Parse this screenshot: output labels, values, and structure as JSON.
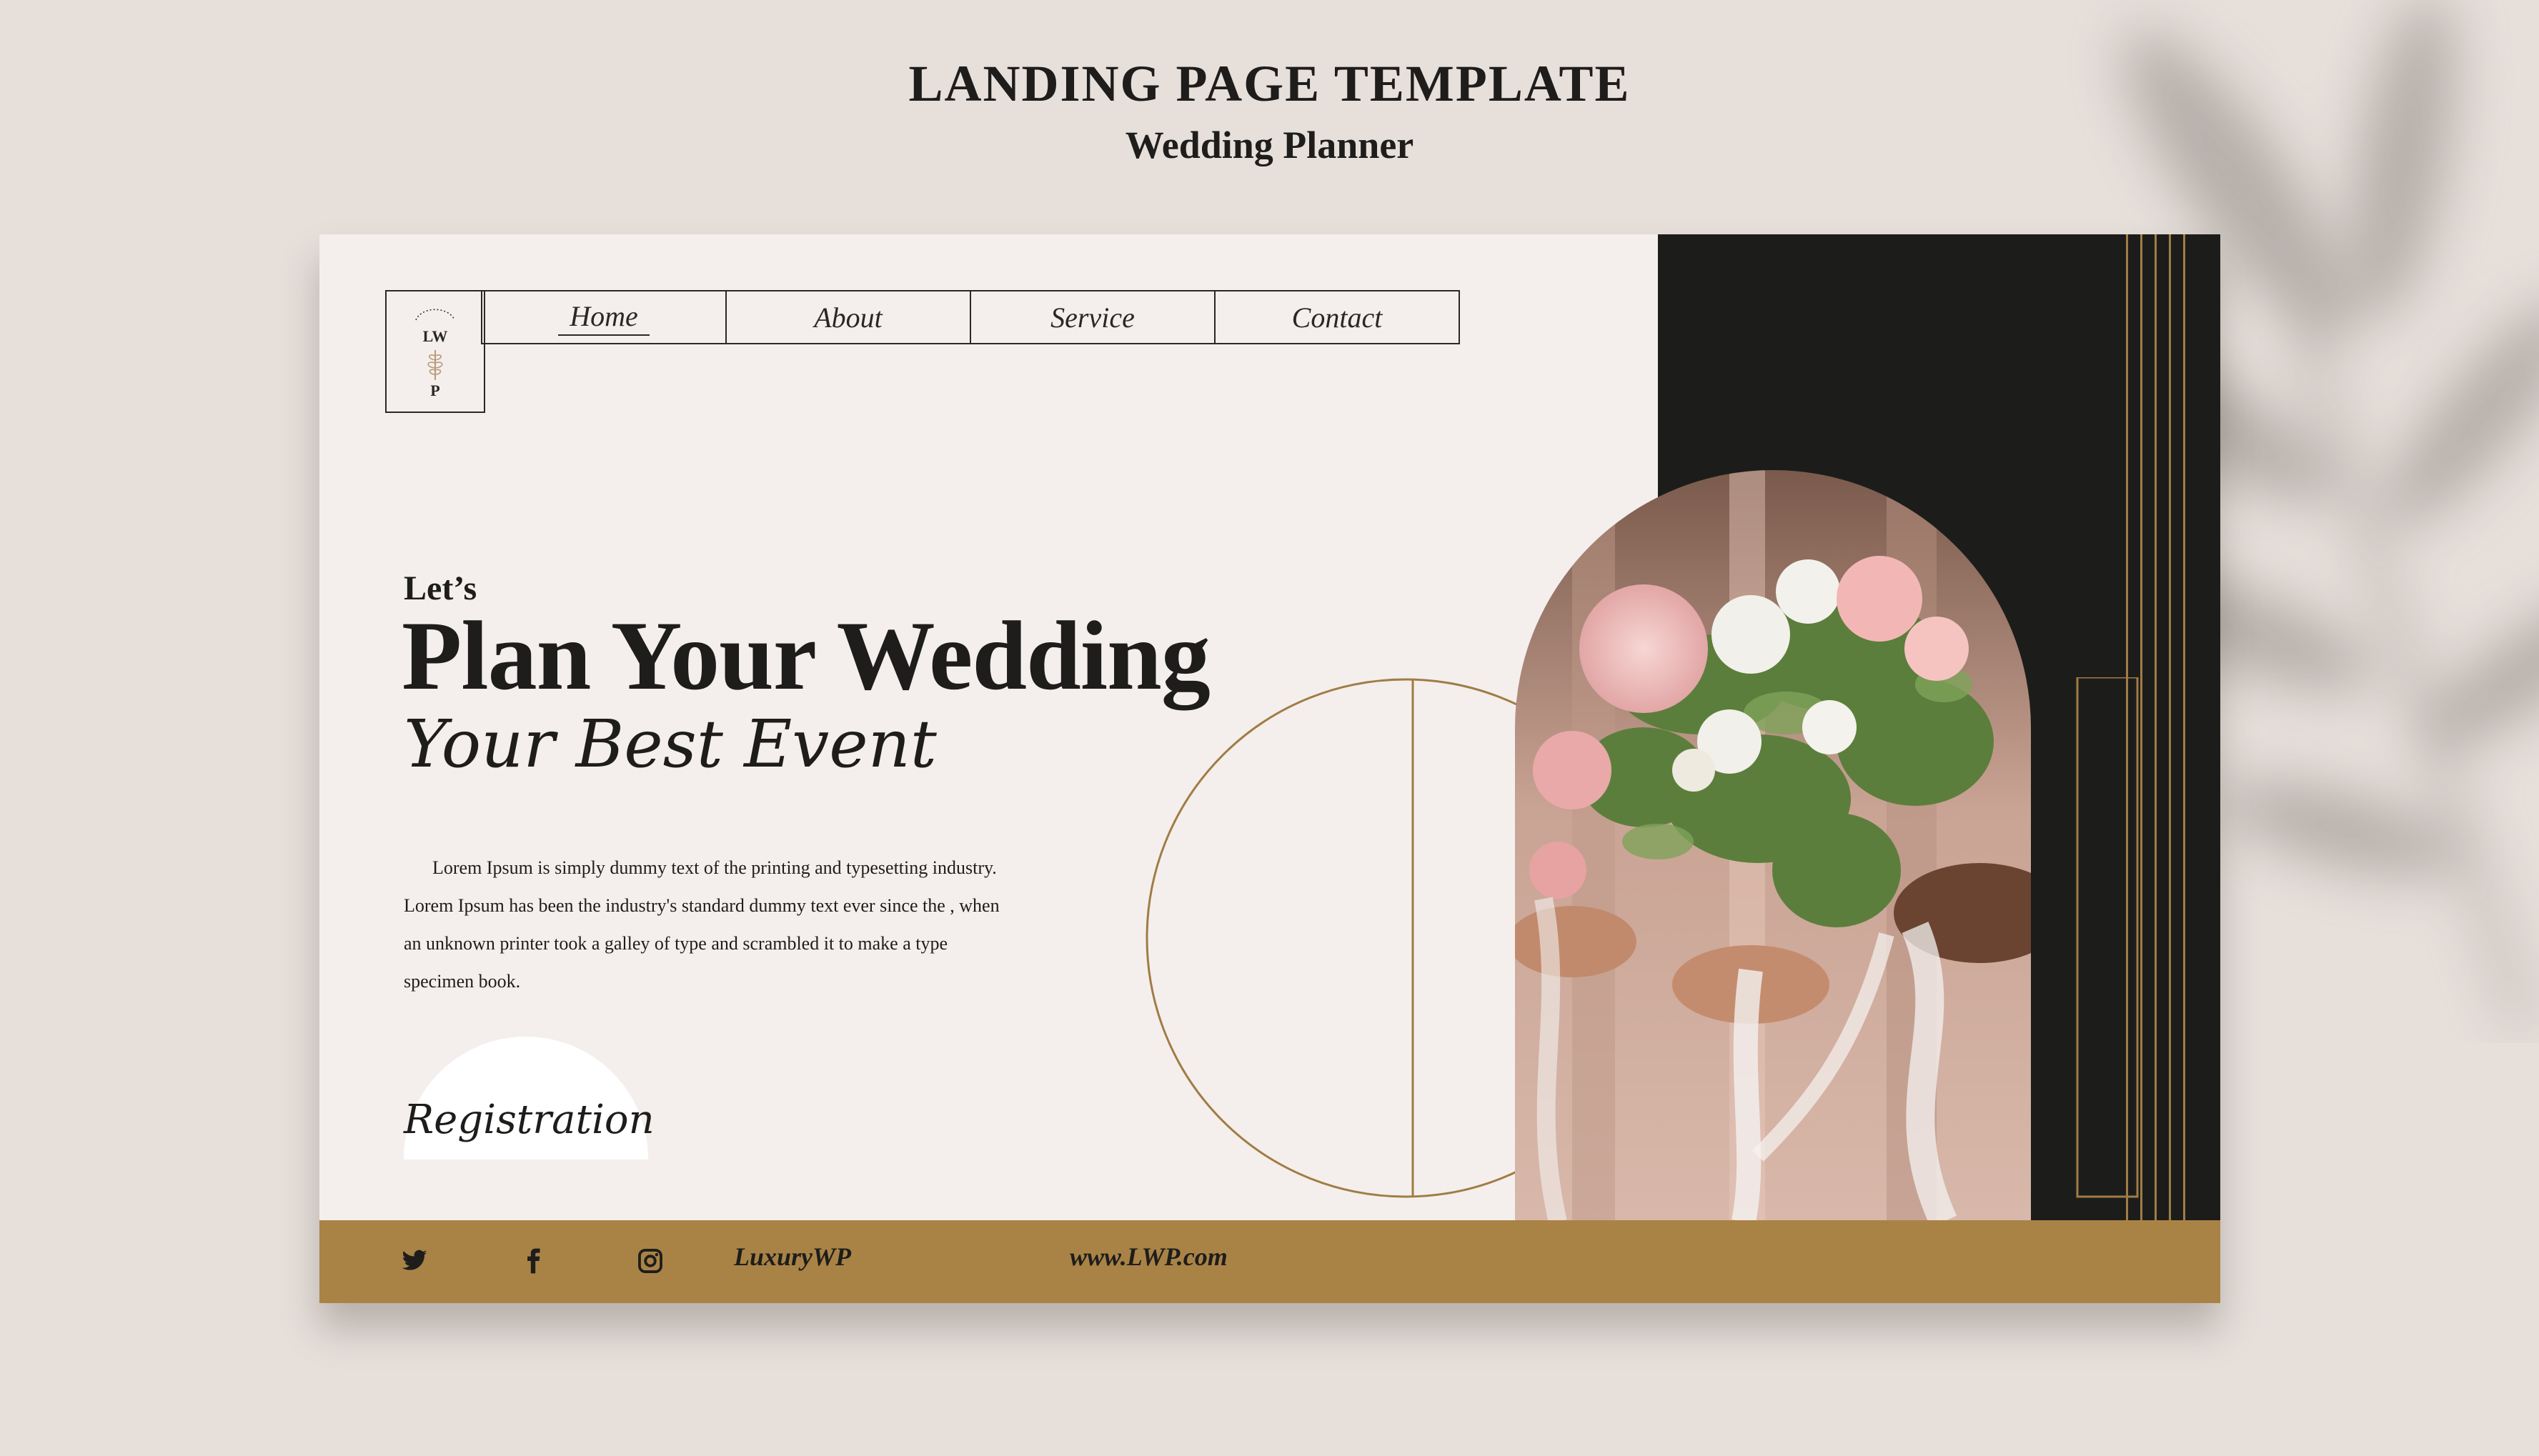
{
  "header": {
    "title": "LANDING PAGE TEMPLATE",
    "subtitle": "Wedding Planner"
  },
  "logo": {
    "top_text": "LW",
    "bottom_text": "P"
  },
  "nav": {
    "items": [
      {
        "label": "Home",
        "active": true
      },
      {
        "label": "About",
        "active": false
      },
      {
        "label": "Service",
        "active": false
      },
      {
        "label": "Contact",
        "active": false
      }
    ]
  },
  "hero": {
    "eyebrow": "Let’s",
    "title": "Plan Your Wedding",
    "script": "Your Best Event",
    "body": "Lorem Ipsum is simply dummy text of the printing and typesetting industry. Lorem Ipsum has been the industry's standard dummy text ever since the , when an unknown printer took a galley of type and scrambled it to make a type specimen book.",
    "cta_label": "Registration"
  },
  "footer": {
    "icons": [
      "twitter-icon",
      "facebook-icon",
      "instagram-icon"
    ],
    "brand": "LuxuryWP",
    "website": "www.LWP.com"
  },
  "colors": {
    "background": "#e6dfda",
    "card": "#f4efec",
    "dark_panel": "#1c1d1a",
    "gold": "#a98346",
    "text": "#1e1d1b"
  }
}
